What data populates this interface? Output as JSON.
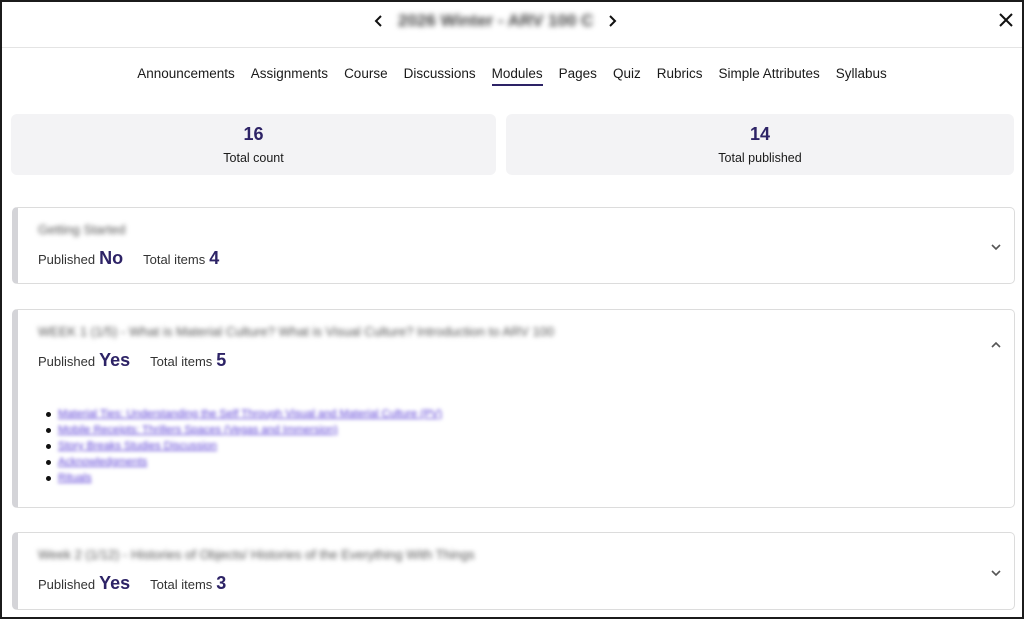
{
  "header": {
    "course_title": "2026 Winter - ARV 100 C"
  },
  "tabs": [
    {
      "label": "Announcements",
      "active": false
    },
    {
      "label": "Assignments",
      "active": false
    },
    {
      "label": "Course",
      "active": false
    },
    {
      "label": "Discussions",
      "active": false
    },
    {
      "label": "Modules",
      "active": true
    },
    {
      "label": "Pages",
      "active": false
    },
    {
      "label": "Quiz",
      "active": false
    },
    {
      "label": "Rubrics",
      "active": false
    },
    {
      "label": "Simple Attributes",
      "active": false
    },
    {
      "label": "Syllabus",
      "active": false
    }
  ],
  "stats": {
    "total_count": {
      "value": "16",
      "label": "Total count"
    },
    "total_published": {
      "value": "14",
      "label": "Total published"
    }
  },
  "modules": [
    {
      "title": "Getting Started",
      "published_label": "Published",
      "published_value": "No",
      "items_label": "Total items",
      "items_value": "4",
      "expanded": false,
      "items": []
    },
    {
      "title": "WEEK 1 (1/5) - What is Material Culture? What is Visual Culture? Introduction to ARV 100",
      "published_label": "Published",
      "published_value": "Yes",
      "items_label": "Total items",
      "items_value": "5",
      "expanded": true,
      "items": [
        "Material Ties: Understanding the Self Through Visual and Material Culture (PV)",
        "Mobile Receipts: Thrillers Spaces (Vegas and Immersion)",
        "Story Breaks Studies Discussion",
        "Acknowledgments",
        "Rituals"
      ]
    },
    {
      "title": "Week 2 (1/12) - Histories of Objects/ Histories of the Everything With Things",
      "published_label": "Published",
      "published_value": "Yes",
      "items_label": "Total items",
      "items_value": "3",
      "expanded": false,
      "items": []
    }
  ],
  "colors": {
    "accent": "#2d2366",
    "link": "#5b3fd6",
    "stat_bg": "#f3f3f5"
  },
  "icons": {
    "prev": "chevron-left-icon",
    "next": "chevron-right-icon",
    "close": "close-icon",
    "expand": "chevron-down-icon",
    "collapse": "chevron-up-icon"
  }
}
